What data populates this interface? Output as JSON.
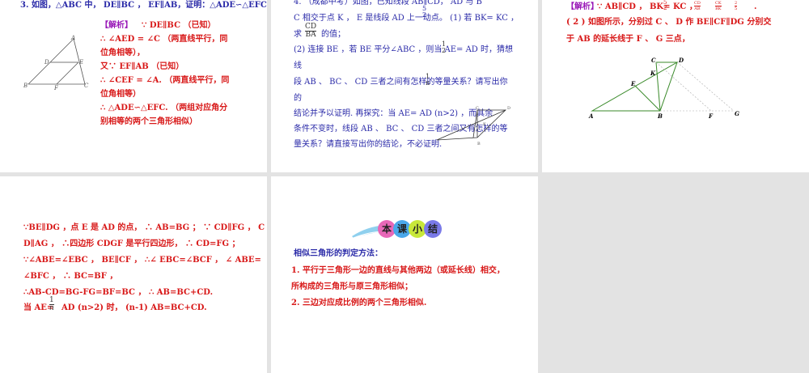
{
  "slides": [
    {
      "title": "3. 如图，△ABC 中， DE∥BC ， EF∥AB，证明：△ADE∽△EFC",
      "analysis_label": "【解析】",
      "lines": [
        "∵ DE∥BC （已知）",
        "∴ ∠AED = ∠C （两直线平行，同",
        "位角相等），",
        "又∵ EF∥AB （已知）",
        "∴ ∠CEF = ∠A. （两直线平行，同",
        "位角相等）",
        "∴ △ADE∽△EFC. （两组对应角分",
        "别相等的两个三角形相似）"
      ],
      "figure_labels": [
        "A",
        "D",
        "E",
        "B",
        "F",
        "C"
      ]
    },
    {
      "lines": [
        "4. （成都中考）如图，已知线段 AB∥CD， AD 与 B",
        "C 相交于点 K ， E 是线段 AD 上一动点。 (1) 若 BK=   KC ，",
        "求",
        "的值；",
        "(2) 连接 BE ，若 BE 平分∠ABC ，则当 AE=   AD 时，猜想",
        "线",
        "段 AB 、 BC 、 CD 三者之间有怎样的等量关系？请写出你",
        "的",
        "结论并予以证明. 再探究：当 AE=   AD (n>2) ，而其余",
        "条件不变时，线段 AB 、 BC 、 CD 三者之间又有怎样的等",
        "量关系？请直接写出你的结论，不必证明."
      ],
      "frac_cd_ba": {
        "num": "CD",
        "den": "BA"
      },
      "frac_5_2": {
        "num": "5",
        "den": "2"
      },
      "frac_1_2": {
        "num": "1",
        "den": "2"
      },
      "frac_1_n": {
        "num": "1",
        "den": "n"
      },
      "figure_labels": [
        "C",
        "D",
        "K",
        "B"
      ]
    },
    {
      "analysis_label": "【解析】",
      "line1_a": "∵ AB∥CD ， BK=",
      "line1_b": "KC ，",
      "line1_end": ".",
      "frac_5_2": {
        "num": "5",
        "den": "2"
      },
      "frac_cd_ab": {
        "num": "CD",
        "den": "AB"
      },
      "frac_ck_bk": {
        "num": "CK",
        "den": "BK"
      },
      "frac_2_5": {
        "num": "2",
        "den": "5"
      },
      "lines": [
        "( 2 ) 如图所示，分别过 C 、 D 作 BE∥CF∥DG 分别交",
        "于 AB 的延长线于 F 、 G 三点，"
      ],
      "figure_labels": [
        "C",
        "D",
        "K",
        "E",
        "A",
        "B",
        "F",
        "G"
      ]
    },
    {
      "lines": [
        "∵BE∥DG ，点 E 是 AD 的点， ∴ AB=BG ； ∵ CD∥FG ， C",
        "D∥AG ， ∴四边形 CDGF 是平行四边形， ∴ CD=FG ；",
        "∵∠ABE=∠EBC ， BE∥CF ， ∴∠ EBC=∠BCF ， ∠ ABE=",
        "∠BFC ， ∴ BC=BF ，",
        "∴AB-CD=BG-FG=BF=BC ， ∴ AB=BC+CD."
      ],
      "last_a": "当 AE=",
      "last_b": "AD (n>2) 时， (n-1) AB=BC+CD.",
      "frac_1_n": {
        "num": "1",
        "den": "n"
      }
    },
    {
      "banner": [
        "本",
        "课",
        "小",
        "结"
      ],
      "heading": "相似三角形的判定方法：",
      "lines": [
        "1. 平行于三角形一边的直线与其他两边（或延长线）相交，",
        "所构成的三角形与原三角形相似；",
        "2. 三边对应成比例的两个三角形相似."
      ]
    }
  ],
  "colors": {
    "blue": "#2a2aa8",
    "red": "#d81818",
    "purple": "#9a1ab8",
    "green": "#3a8a2a"
  }
}
